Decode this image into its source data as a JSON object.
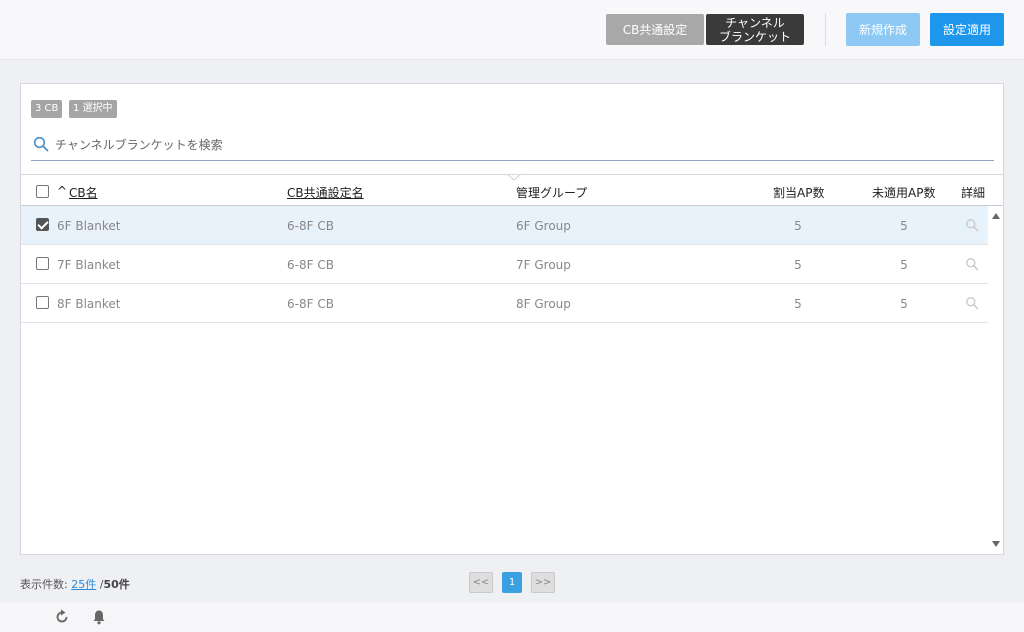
{
  "toolbar": {
    "cb_settings_label": "CB共通設定",
    "channel_blanket_label": "チャンネル\nブランケット",
    "new_label": "新規作成",
    "apply_label": "設定適用"
  },
  "badges": {
    "count": "3 CB",
    "selected": "1 選択中"
  },
  "search": {
    "placeholder": "チャンネルブランケットを検索"
  },
  "table": {
    "sort_indicator": "^",
    "headers": {
      "cb_name": "CB名",
      "cb_settings_name": "CB共通設定名",
      "group": "管理グループ",
      "assigned_ap": "割当AP数",
      "unapplied_ap": "未適用AP数",
      "details": "詳細"
    },
    "rows": [
      {
        "checked": true,
        "cb_name": "6F Blanket",
        "cb_settings_name": "6-8F CB",
        "group": "6F Group",
        "assigned_ap": "5",
        "unapplied_ap": "5"
      },
      {
        "checked": false,
        "cb_name": "7F Blanket",
        "cb_settings_name": "6-8F CB",
        "group": "7F Group",
        "assigned_ap": "5",
        "unapplied_ap": "5"
      },
      {
        "checked": false,
        "cb_name": "8F Blanket",
        "cb_settings_name": "6-8F CB",
        "group": "8F Group",
        "assigned_ap": "5",
        "unapplied_ap": "5"
      }
    ]
  },
  "footer": {
    "count_label": "表示件数:",
    "per_page": "25件",
    "separator": "/",
    "total": "50件"
  },
  "pagination": {
    "prev": "<<",
    "current": "1",
    "next": ">>"
  },
  "colors": {
    "accent": "#1e96ec",
    "accent_light": "#8ec8f4",
    "selected_row": "#e8f2fb"
  },
  "icons": {
    "search": "search-icon",
    "details": "magnifier-icon",
    "refresh": "refresh-icon",
    "notifications": "bell-icon"
  }
}
